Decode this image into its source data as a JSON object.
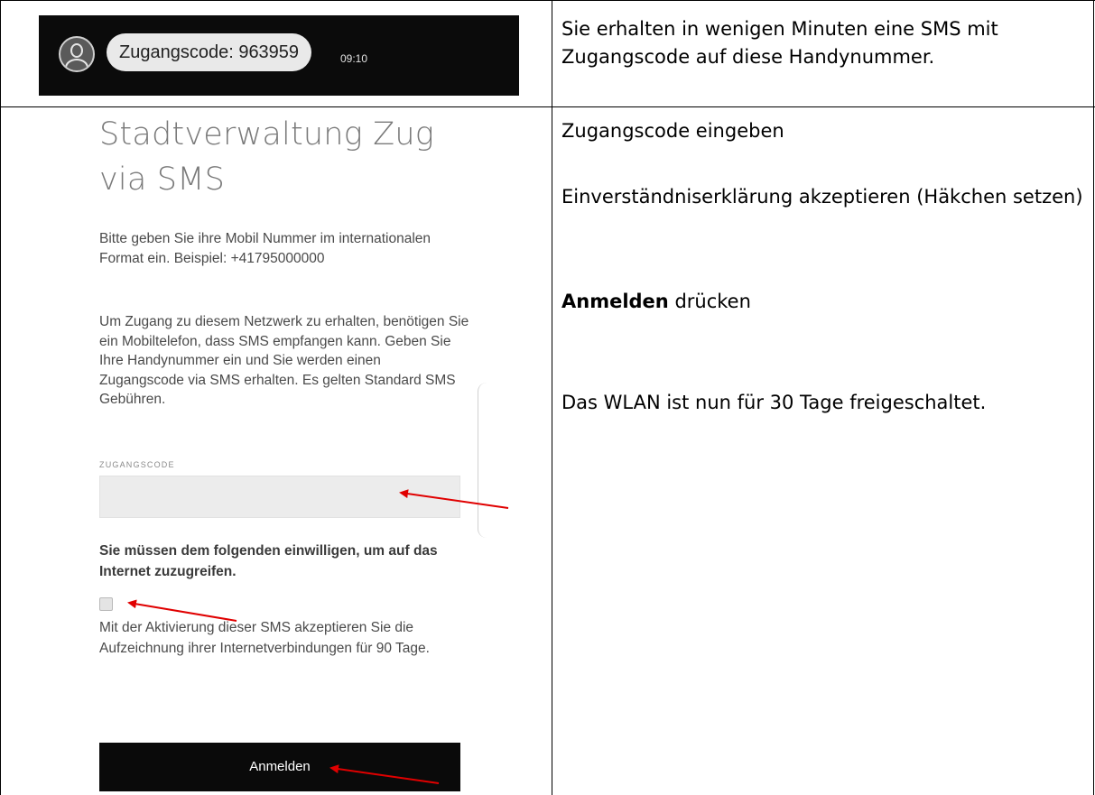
{
  "sms_notification": {
    "message": "Zugangscode: 963959",
    "time": "09:10"
  },
  "portal": {
    "title": "Stadtverwaltung Zug via SMS",
    "intro": "Bitte geben Sie ihre Mobil Nummer im internationalen Format ein. Beispiel: +41795000000",
    "description": "Um Zugang zu diesem Netzwerk zu erhalten, benötigen Sie ein Mobiltelefon, dass SMS empfangen kann. Geben Sie Ihre Handynummer ein und Sie werden einen Zugangscode via SMS erhalten. Es gelten Standard SMS Gebühren.",
    "code_label": "ZUGANGSCODE",
    "code_value": "",
    "consent_heading": "Sie müssen dem folgenden einwilligen, um auf das Internet zuzugreifen.",
    "consent_checked": false,
    "consent_text": "Mit der Aktivierung dieser SMS akzeptieren Sie die Aufzeichnung ihrer Internetverbindungen für 90 Tage.",
    "login_button": "Anmelden"
  },
  "instructions": {
    "row1": "Sie erhalten in wenigen Minuten eine SMS mit Zugangscode auf diese Handynummer.",
    "step_code": "Zugangscode eingeben",
    "step_consent": "Einverständniserklärung akzeptieren (Häkchen setzen)",
    "step_login_bold": "Anmelden",
    "step_login_rest": " drücken",
    "step_done": "Das WLAN ist nun für 30 Tage freigeschaltet."
  },
  "colors": {
    "arrow": "#e00000",
    "button_bg": "#0a0a0a",
    "sms_bar_bg": "#0b0b0b"
  }
}
